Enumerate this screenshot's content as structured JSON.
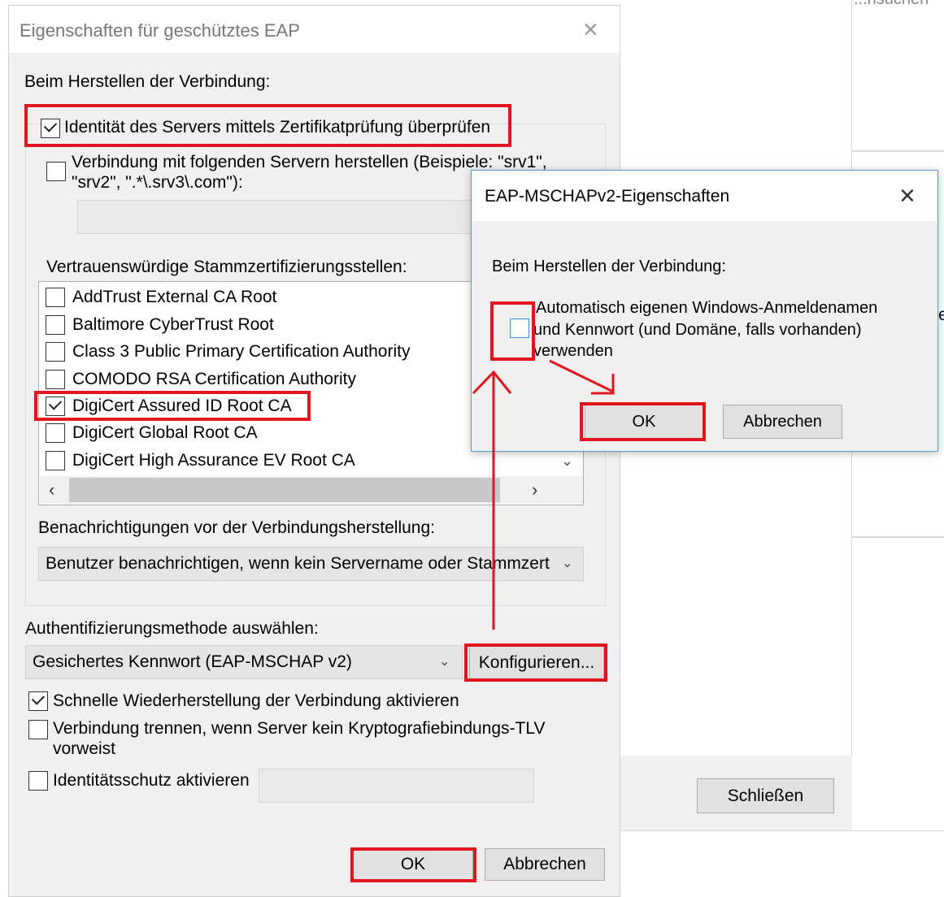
{
  "background_window": {
    "top_text": "...nsuchen",
    "close_button": "Schließen"
  },
  "peap_dialog": {
    "title": "Eigenschaften für geschütztes EAP",
    "section_label": "Beim Herstellen der Verbindung:",
    "verify_server_identity": {
      "label": "Identität des Servers mittels Zertifikatprüfung überprüfen",
      "checked": true
    },
    "connect_to_servers": {
      "label_line1": "Verbindung mit folgenden Servern herstellen (Beispiele: \"srv1\",",
      "label_line2": "\"srv2\", \".*\\.srv3\\.com\"):",
      "checked": false,
      "value": ""
    },
    "trusted_roots_label": "Vertrauenswürdige Stammzertifizierungsstellen:",
    "trusted_roots": [
      {
        "name": "AddTrust External CA Root",
        "checked": false
      },
      {
        "name": "Baltimore CyberTrust Root",
        "checked": false
      },
      {
        "name": "Class 3 Public Primary Certification Authority",
        "checked": false
      },
      {
        "name": "COMODO RSA Certification Authority",
        "checked": false
      },
      {
        "name": "DigiCert Assured ID Root CA",
        "checked": true
      },
      {
        "name": "DigiCert Global Root CA",
        "checked": false
      },
      {
        "name": "DigiCert High Assurance EV Root CA",
        "checked": false
      }
    ],
    "notifications_label": "Benachrichtigungen vor der Verbindungsherstellung:",
    "notifications_value": "Benutzer benachrichtigen, wenn kein Servername oder Stammzert",
    "auth_method_label": "Authentifizierungsmethode auswählen:",
    "auth_method_value": "Gesichertes Kennwort (EAP-MSCHAP v2)",
    "configure_button": "Konfigurieren...",
    "fast_reconnect": {
      "label": "Schnelle Wiederherstellung der Verbindung aktivieren",
      "checked": true
    },
    "disconnect_no_tlv": {
      "label_line1": "Verbindung trennen, wenn Server kein Kryptografiebindungs-TLV",
      "label_line2": "vorweist",
      "checked": false
    },
    "identity_privacy": {
      "label": "Identitätsschutz aktivieren",
      "checked": false,
      "value": ""
    },
    "ok_button": "OK",
    "cancel_button": "Abbrechen"
  },
  "mschap_dialog": {
    "title": "EAP-MSCHAPv2-Eigenschaften",
    "section_label": "Beim Herstellen der Verbindung:",
    "auto_windows_logon": {
      "label_line1": "Automatisch eigenen Windows-Anmeldenamen",
      "label_line2": "und Kennwort (und Domäne, falls vorhanden)",
      "label_line3": "verwenden",
      "checked": false
    },
    "ok_button": "OK",
    "cancel_button": "Abbrechen"
  },
  "colors": {
    "annotation_red": "#e0161e",
    "checkbox_focus_blue": "#3d8ee0"
  }
}
